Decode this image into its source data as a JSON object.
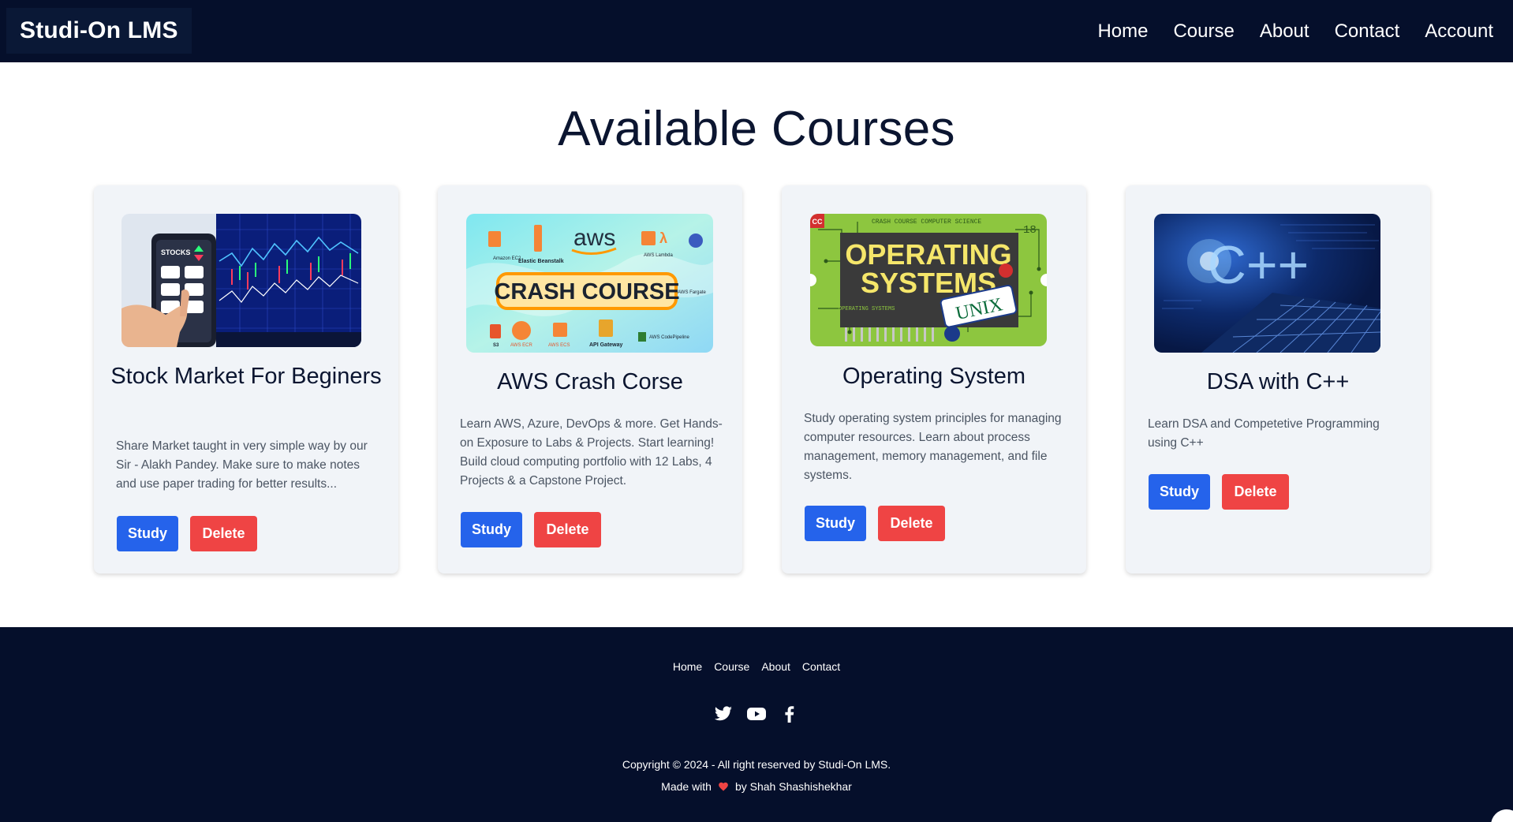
{
  "header": {
    "brand": "Studi-On LMS",
    "nav": [
      "Home",
      "Course",
      "About",
      "Contact",
      "Account"
    ]
  },
  "main": {
    "title": "Available Courses",
    "courses": [
      {
        "title": "Stock Market For Beginers",
        "description": "Share Market taught in very simple way by our Sir - Alakh Pandey. Make sure to make notes and use paper trading for better results...",
        "study_label": "Study",
        "delete_label": "Delete",
        "thumb_label": "STOCKS"
      },
      {
        "title": "AWS Crash Corse",
        "description": "Learn AWS, Azure, DevOps & more. Get Hands-on Exposure to Labs & Projects. Start learning! Build cloud computing portfolio with 12 Labs, 4 Projects & a Capstone Project.",
        "study_label": "Study",
        "delete_label": "Delete",
        "thumb_logo": "aws",
        "thumb_banner": "CRASH COURSE",
        "thumb_services": [
          "Amazon EC2",
          "Elastic Beanstalk",
          "AWS Lambda",
          "S3",
          "AWS ECR",
          "AWS ECS",
          "API Gateway",
          "AWS CodePipeline",
          "AWS Fargate"
        ]
      },
      {
        "title": "Operating System",
        "description": "Study operating system principles for managing computer resources. Learn about process management, memory management, and file systems.",
        "study_label": "Study",
        "delete_label": "Delete",
        "thumb_header": "CRASH COURSE COMPUTER SCIENCE",
        "thumb_number": "18",
        "thumb_title_1": "OPERATING",
        "thumb_title_2": "SYSTEMS",
        "thumb_sub": "OPERATING SYSTEMS",
        "thumb_plate": "UNIX",
        "thumb_badge": "CC"
      },
      {
        "title": "DSA with C++",
        "description": "Learn DSA and Competetive Programming using C++",
        "study_label": "Study",
        "delete_label": "Delete",
        "thumb_text": "C++"
      }
    ]
  },
  "footer": {
    "links": [
      "Home",
      "Course",
      "About",
      "Contact"
    ],
    "social": [
      "twitter-icon",
      "youtube-icon",
      "facebook-icon"
    ],
    "copyright": "Copyright © 2024 - All right reserved by Studi-On LMS.",
    "made_with_prefix": "Made with",
    "made_with_suffix": "by Shah Shashishekhar"
  },
  "colors": {
    "header_bg": "#050f2b",
    "study_button": "#2563eb",
    "delete_button": "#ef4444",
    "card_bg": "#f1f4f8",
    "heart": "#ef4444"
  }
}
